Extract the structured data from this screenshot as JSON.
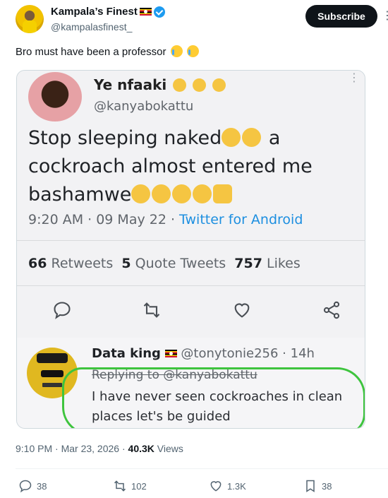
{
  "author": {
    "name": "Kampala’s Finest",
    "handle": "@kampalasfinest_"
  },
  "subscribe_label": "Subscribe",
  "tweet_text": "Bro must have been a professor",
  "embedded": {
    "name": "Ye nfaaki",
    "handle": "@kanyabokattu",
    "text_line1": "Stop sleeping naked",
    "text_line1_end": "a",
    "text_line2": "cockroach almost entered me",
    "text_line3": "bashamwe",
    "time": "9:20 AM · 09 May 22 · ",
    "source": "Twitter for Android",
    "retweets_count": "66",
    "retweets_label": "Retweets",
    "quotes_count": "5",
    "quotes_label": "Quote Tweets",
    "likes_count": "757",
    "likes_label": "Likes"
  },
  "reply": {
    "name": "Data king",
    "handle": "@tonytonie256 · 14h",
    "replying": "Replying to @kanyabokattu",
    "text": "I have never seen cockroaches in clean places let's be guided"
  },
  "meta": {
    "time": "9:10 PM · Mar 23, 2026 · ",
    "views_count": "40.3K",
    "views_label": " Views"
  },
  "actions": {
    "replies": "38",
    "reposts": "102",
    "likes": "1.3K",
    "bookmarks": "38"
  },
  "colors": {
    "accent": "#1d9bf0",
    "highlight_ring": "#3ec43e",
    "button": "#0f1419"
  }
}
